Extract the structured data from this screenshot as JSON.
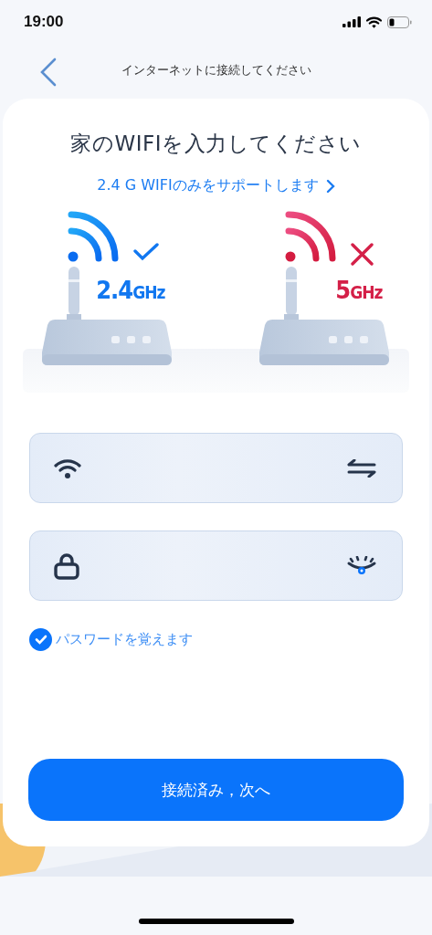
{
  "status_bar": {
    "time": "19:00"
  },
  "nav": {
    "title": "インターネットに接続してください"
  },
  "card": {
    "heading": "家のWIFIを入力してください",
    "support_link": "2.4 G WIFIのみをサポートします",
    "bands": [
      {
        "number": "2.4",
        "unit": "GHz",
        "supported": true
      },
      {
        "number": "5",
        "unit": "GHz",
        "supported": false
      }
    ],
    "fields": [
      {
        "kind": "network"
      },
      {
        "kind": "password"
      }
    ],
    "remember": {
      "label": "パスワードを覚えます",
      "checked": true
    },
    "button": "接続済み，次へ"
  }
}
